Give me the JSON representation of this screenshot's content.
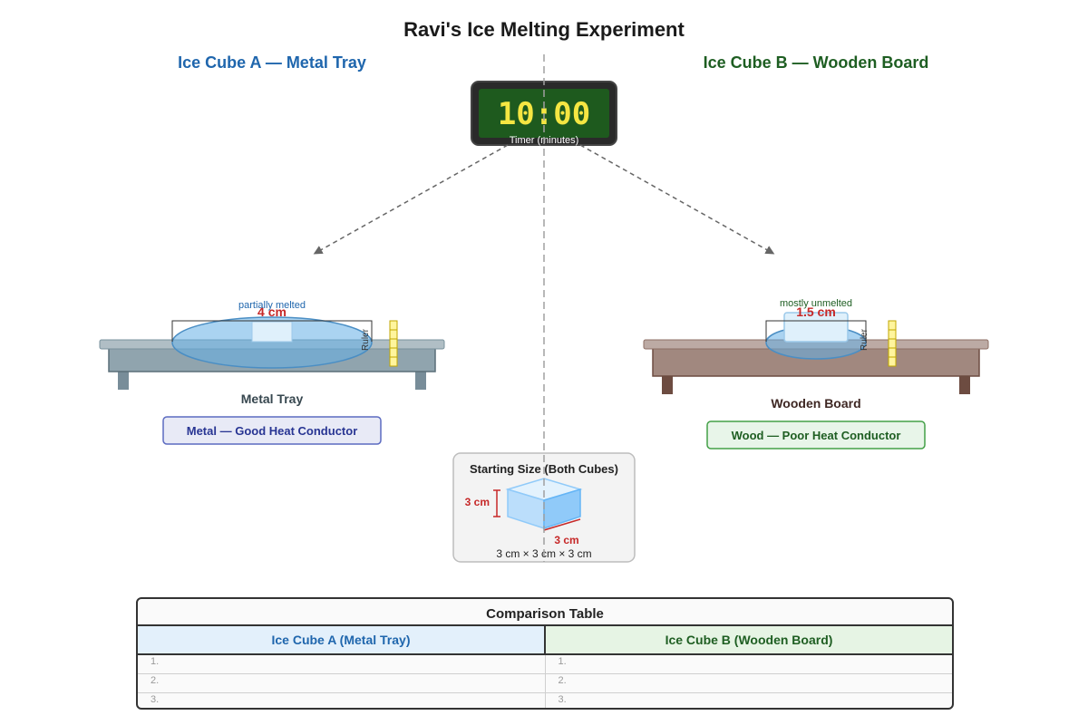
{
  "title": "Ravi's Ice Melting Experiment",
  "left": {
    "heading": "Ice Cube A — Metal Tray",
    "note": "partially melted",
    "size": "4 cm",
    "ruler": "Ruler",
    "surface": "Metal Tray",
    "conductor": "Metal — Good Heat Conductor"
  },
  "right": {
    "heading": "Ice Cube B — Wooden Board",
    "note": "mostly unmelted",
    "size": "1.5 cm",
    "ruler": "Ruler",
    "surface": "Wooden Board",
    "conductor": "Wood — Poor Heat Conductor"
  },
  "timer": {
    "value": "10:00",
    "label": "Timer (minutes)"
  },
  "starting": {
    "title": "Starting Size (Both Cubes)",
    "height": "3 cm",
    "width": "3 cm",
    "dims": "3 cm × 3 cm × 3 cm"
  },
  "table": {
    "title": "Comparison Table",
    "col_a": "Ice Cube A (Metal Tray)",
    "col_b": "Ice Cube B (Wooden Board)",
    "rows": [
      {
        "a": "1.",
        "b": "1."
      },
      {
        "a": "2.",
        "b": "2."
      },
      {
        "a": "3.",
        "b": "3."
      }
    ]
  },
  "colors": {
    "left_accent": "#1f66ad",
    "right_accent": "#1e5e22",
    "timer_digits": "#f5e642",
    "dimension_red": "#c62828"
  }
}
